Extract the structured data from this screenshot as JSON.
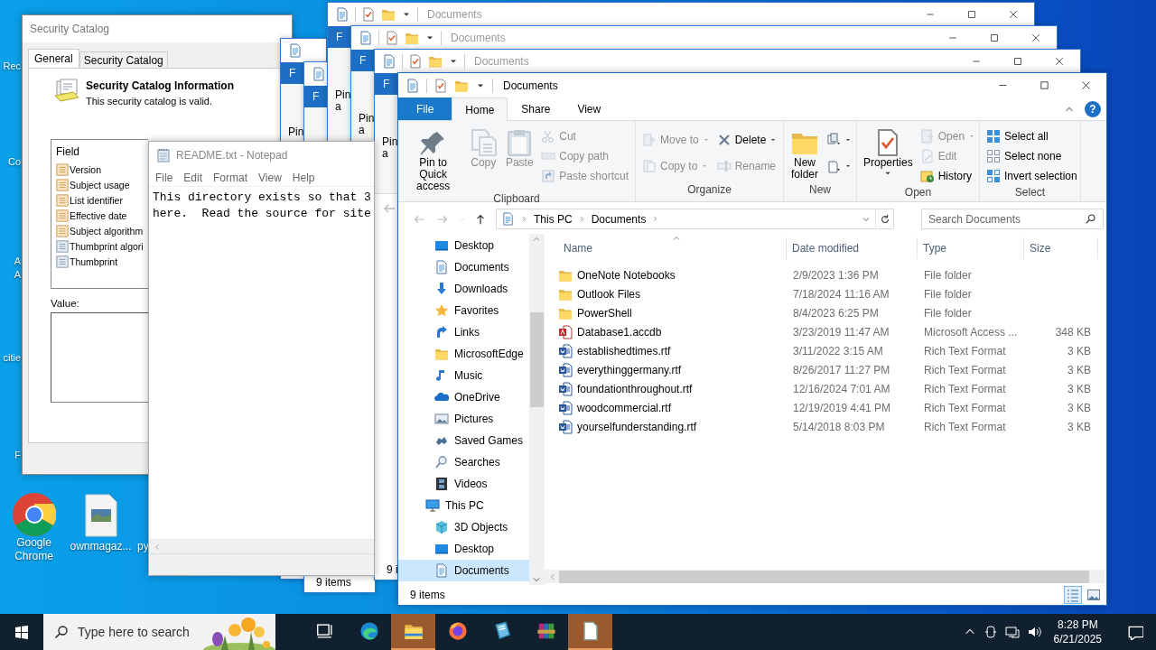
{
  "desktop": {
    "icons": [
      {
        "label": "Rec"
      },
      {
        "label": "Co"
      },
      {
        "label": "A\nA"
      },
      {
        "label": "citie"
      },
      {
        "label": "F"
      },
      {
        "label": "Google Chrome"
      },
      {
        "label": "ownmagaz..."
      },
      {
        "label": "py"
      }
    ]
  },
  "security_catalog": {
    "title": "Security Catalog",
    "tabs": [
      {
        "label": "General",
        "selected": true
      },
      {
        "label": "Security Catalog",
        "selected": false
      }
    ],
    "heading": "Security Catalog Information",
    "status": "This security catalog is valid.",
    "field_header": "Field",
    "fields": [
      {
        "label": "Version",
        "kind": "standard"
      },
      {
        "label": "Subject usage",
        "kind": "standard"
      },
      {
        "label": "List identifier",
        "kind": "standard"
      },
      {
        "label": "Effective date",
        "kind": "standard"
      },
      {
        "label": "Subject algorithm",
        "kind": "standard"
      },
      {
        "label": "Thumbprint algori",
        "kind": "extended"
      },
      {
        "label": "Thumbprint",
        "kind": "extended"
      }
    ],
    "value_label": "Value:"
  },
  "background_windows": [
    {
      "file_tab": "F",
      "pin_label": "Pin"
    },
    {
      "file_tab": "F",
      "status": "9 items"
    },
    {
      "title": "Documents",
      "file_tab": "F",
      "pin_label": "Pin\na"
    },
    {
      "title": "Documents",
      "file_tab": "F",
      "pin_label": "Pin\na"
    },
    {
      "title": "Documents",
      "file_tab": "F",
      "pin_label": "Pin\na",
      "shows_nav": true,
      "status": "9 i"
    }
  ],
  "notepad": {
    "title": "README.txt - Notepad",
    "menu": [
      "File",
      "Edit",
      "Format",
      "View",
      "Help"
    ],
    "lines": [
      "This directory exists so that 3",
      "here.  Read the source for site"
    ]
  },
  "explorer": {
    "title": "Documents",
    "tabs": [
      {
        "label": "File",
        "kind": "file",
        "selected": false
      },
      {
        "label": "Home",
        "kind": "tab",
        "selected": true
      },
      {
        "label": "Share",
        "kind": "tab",
        "selected": false
      },
      {
        "label": "View",
        "kind": "tab",
        "selected": false
      }
    ],
    "help": "?",
    "ribbon": [
      {
        "label": "Clipboard",
        "items": [
          {
            "kind": "large",
            "label": "Pin to Quick access",
            "disabled": false
          },
          {
            "kind": "large",
            "label": "Copy",
            "disabled": true
          },
          {
            "kind": "large",
            "label": "Paste",
            "disabled": true
          },
          {
            "kind": "column",
            "items": [
              {
                "label": "Cut",
                "disabled": true
              },
              {
                "label": "Copy path",
                "disabled": true
              },
              {
                "label": "Paste shortcut",
                "disabled": true
              }
            ]
          }
        ]
      },
      {
        "label": "Organize",
        "items": [
          {
            "kind": "column",
            "items": [
              {
                "label": "Move to",
                "disabled": true,
                "dropdown": true
              },
              {
                "label": "Copy to",
                "disabled": true,
                "dropdown": true
              }
            ]
          },
          {
            "kind": "column",
            "items": [
              {
                "label": "Delete",
                "disabled": false,
                "dropdown": true
              },
              {
                "label": "Rename",
                "disabled": true
              }
            ]
          }
        ]
      },
      {
        "label": "New",
        "items": [
          {
            "kind": "large",
            "label": "New folder",
            "disabled": false
          },
          {
            "kind": "column",
            "items": [
              {
                "disabled": false,
                "dropdown": true
              },
              {
                "disabled": false,
                "dropdown": true
              }
            ]
          }
        ]
      },
      {
        "label": "Open",
        "items": [
          {
            "kind": "large",
            "label": "Properties",
            "disabled": false,
            "dropdown": true
          },
          {
            "kind": "column",
            "items": [
              {
                "label": "Open",
                "disabled": true,
                "dropdown": true
              },
              {
                "label": "Edit",
                "disabled": true
              },
              {
                "label": "History",
                "disabled": false
              }
            ]
          }
        ]
      },
      {
        "label": "Select",
        "items": [
          {
            "kind": "column",
            "items": [
              {
                "label": "Select all",
                "disabled": false
              },
              {
                "label": "Select none",
                "disabled": false
              },
              {
                "label": "Invert selection",
                "disabled": false
              }
            ]
          }
        ]
      }
    ],
    "address": {
      "segments": [
        "This PC",
        "Documents"
      ]
    },
    "search": {
      "placeholder": "Search Documents"
    },
    "nav": [
      {
        "label": "Desktop",
        "selected": false
      },
      {
        "label": "Documents",
        "selected": false
      },
      {
        "label": "Downloads",
        "selected": false
      },
      {
        "label": "Favorites",
        "selected": false
      },
      {
        "label": "Links",
        "selected": false
      },
      {
        "label": "MicrosoftEdge",
        "selected": false
      },
      {
        "label": "Music",
        "selected": false
      },
      {
        "label": "OneDrive",
        "selected": false
      },
      {
        "label": "Pictures",
        "selected": false
      },
      {
        "label": "Saved Games",
        "selected": false
      },
      {
        "label": "Searches",
        "selected": false
      },
      {
        "label": "Videos",
        "selected": false
      },
      {
        "label": "This PC",
        "selected": false,
        "children": [
          {
            "label": "3D Objects",
            "selected": false
          },
          {
            "label": "Desktop",
            "selected": false
          },
          {
            "label": "Documents",
            "selected": true
          }
        ]
      }
    ],
    "columns": [
      {
        "label": "Name",
        "sorted": true
      },
      {
        "label": "Date modified",
        "sorted": false
      },
      {
        "label": "Type",
        "sorted": false
      },
      {
        "label": "Size",
        "sorted": false
      }
    ],
    "rows": [
      {
        "kind": "folder",
        "name": "OneNote Notebooks",
        "date": "2/9/2023 1:36 PM",
        "type": "File folder"
      },
      {
        "kind": "folder",
        "name": "Outlook Files",
        "date": "7/18/2024 11:16 AM",
        "type": "File folder"
      },
      {
        "kind": "folder",
        "name": "PowerShell",
        "date": "8/4/2023 6:25 PM",
        "type": "File folder"
      },
      {
        "kind": "access",
        "name": "Database1.accdb",
        "date": "3/23/2019 11:47 AM",
        "type": "Microsoft Access ...",
        "size": "348 KB"
      },
      {
        "kind": "rtf",
        "name": "establishedtimes.rtf",
        "date": "3/11/2022 3:15 AM",
        "type": "Rich Text Format",
        "size": "3 KB"
      },
      {
        "kind": "rtf",
        "name": "everythinggermany.rtf",
        "date": "8/26/2017 11:27 PM",
        "type": "Rich Text Format",
        "size": "3 KB"
      },
      {
        "kind": "rtf",
        "name": "foundationthroughout.rtf",
        "date": "12/16/2024 7:01 AM",
        "type": "Rich Text Format",
        "size": "3 KB"
      },
      {
        "kind": "rtf",
        "name": "woodcommercial.rtf",
        "date": "12/19/2019 4:41 PM",
        "type": "Rich Text Format",
        "size": "3 KB"
      },
      {
        "kind": "rtf",
        "name": "yourselfunderstanding.rtf",
        "date": "5/14/2018 8:03 PM",
        "type": "Rich Text Format",
        "size": "3 KB"
      }
    ],
    "status": "9 items"
  },
  "taskbar": {
    "search_placeholder": "Type here to search",
    "apps": [
      {
        "kind": "taskview",
        "highlighted": false
      },
      {
        "kind": "edge",
        "highlighted": false
      },
      {
        "kind": "explorer",
        "highlighted": true
      },
      {
        "kind": "firefox",
        "highlighted": false
      },
      {
        "kind": "notebook",
        "highlighted": false
      },
      {
        "kind": "archive",
        "highlighted": false
      },
      {
        "kind": "notepad",
        "highlighted": true
      }
    ],
    "time": "8:28 PM",
    "date": "6/21/2025"
  }
}
